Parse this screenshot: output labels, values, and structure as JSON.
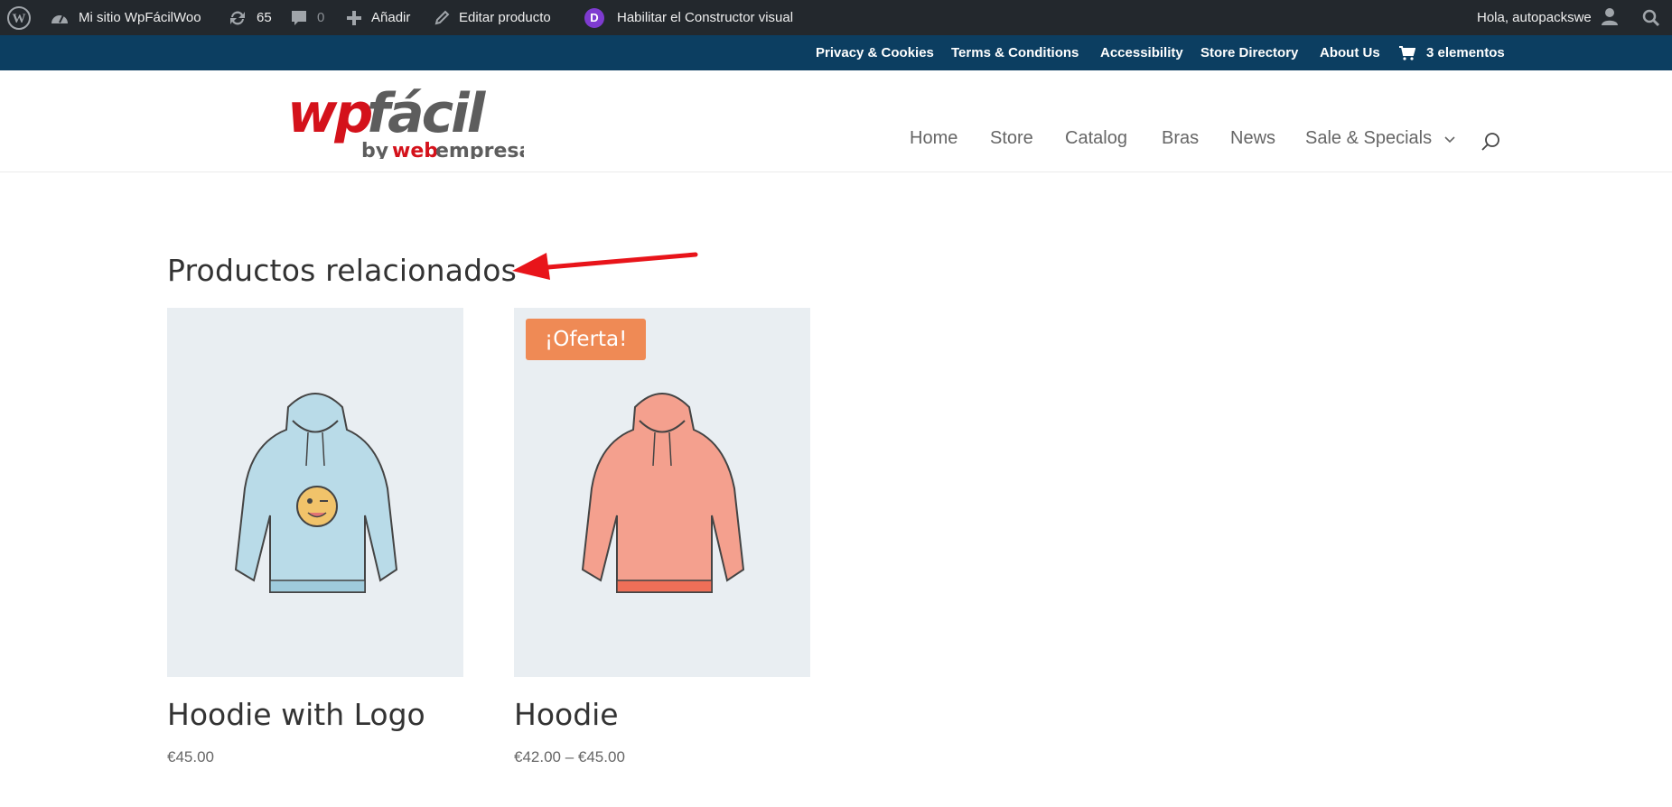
{
  "adminbar": {
    "site_name": "Mi sitio WpFácilWoo",
    "updates_count": "65",
    "comments_count": "0",
    "add_label": "Añadir",
    "edit_label": "Editar producto",
    "builder_label": "Habilitar el Constructor visual",
    "builder_badge": "D",
    "greeting": "Hola, autopackswe"
  },
  "topnav": {
    "links": [
      "Privacy & Cookies",
      "Terms & Conditions",
      "Accessibility",
      "Store Directory",
      "About Us"
    ],
    "cart_label": "3 elementos"
  },
  "logo": {
    "text_wp": "wp",
    "text_facil": "fácil",
    "text_by": "by",
    "text_web": "web",
    "text_empresa": "empresa"
  },
  "mainnav": {
    "items": [
      "Home",
      "Store",
      "Catalog",
      "Bras",
      "News",
      "Sale & Specials"
    ]
  },
  "related": {
    "title": "Productos relacionados",
    "products": [
      {
        "name": "Hoodie with Logo",
        "price": "€45.00",
        "badge": "",
        "color": "#b9dbe8"
      },
      {
        "name": "Hoodie",
        "price": "€42.00 – €45.00",
        "badge": "¡Oferta!",
        "color": "#f4a08e"
      }
    ]
  },
  "colors": {
    "adminbar_bg": "#23282d",
    "topnav_bg": "#0c3e61",
    "sale_badge": "#ef8a55",
    "arrow": "#e8141a"
  }
}
